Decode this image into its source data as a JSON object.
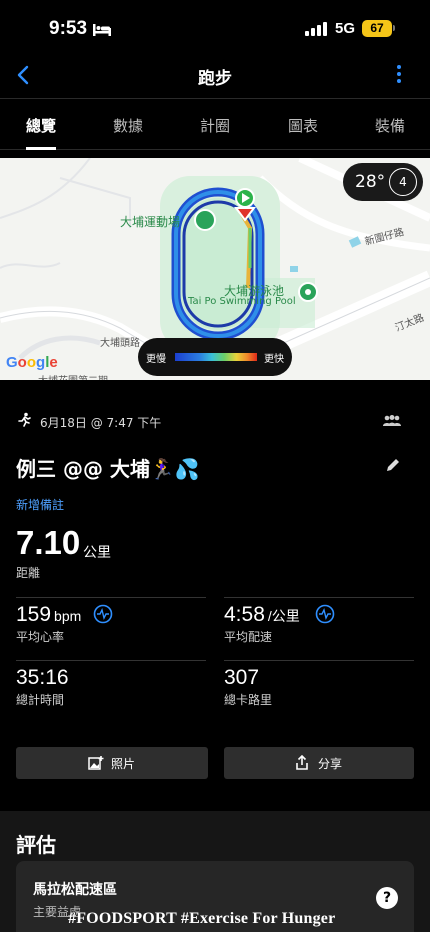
{
  "status_bar": {
    "time": "9:53",
    "network": "5G",
    "battery": "67"
  },
  "nav": {
    "title": "跑步"
  },
  "tabs": [
    {
      "label": "總覽"
    },
    {
      "label": "數據"
    },
    {
      "label": "計圈"
    },
    {
      "label": "圖表"
    },
    {
      "label": "裝備"
    }
  ],
  "map": {
    "labels": {
      "stadium": "大埔運動場",
      "pool_zh": "大埔游泳池",
      "pool_en": "Tai Po Swimming Pool",
      "road1": "新圍仔路",
      "road2": "汀太路",
      "road3": "大埔頭路",
      "road4": "大埔花園第二期"
    },
    "temperature": "28°",
    "wind": "4",
    "pace_legend": {
      "slow": "更慢",
      "fast": "更快"
    },
    "google": "Google",
    "colors": {
      "route_outer": "#1f4fd0",
      "route_inner": "#2f8fe8",
      "field": "#c9ecd3",
      "start": "#2cb34a",
      "finish": "#e0332a"
    }
  },
  "activity": {
    "date": "6月18日 @ 7:47 下午",
    "title": "例三 @@ 大埔🏃‍♀️💦",
    "add_note": "新增備註",
    "distance_value": "7.10",
    "distance_unit": "公里",
    "distance_label": "距離"
  },
  "stats": {
    "avg_hr_value": "159",
    "avg_hr_unit": "bpm",
    "avg_hr_label": "平均心率",
    "avg_pace_value": "4:58",
    "avg_pace_unit": "/公里",
    "avg_pace_label": "平均配速",
    "total_time_value": "35:16",
    "total_time_label": "總計時間",
    "calories_value": "307",
    "calories_label": "總卡路里"
  },
  "actions": {
    "photos": "照片",
    "share": "分享"
  },
  "evaluation": {
    "title": "評估",
    "card_title": "馬拉松配速區",
    "card_subtitle": "主要益處"
  },
  "watermark": "#FOODSPORT #Exercise For Hunger"
}
